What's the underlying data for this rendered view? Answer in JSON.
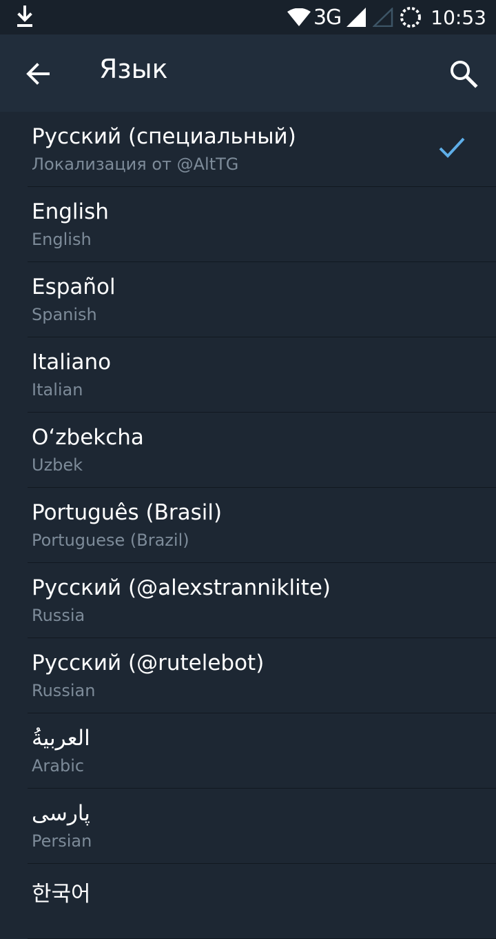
{
  "status_bar": {
    "network": "3G",
    "time": "10:53"
  },
  "header": {
    "title": "Язык"
  },
  "languages": [
    {
      "name": "Русский (специальный)",
      "subtitle": "Локализация от @AltTG",
      "selected": true
    },
    {
      "name": "English",
      "subtitle": "English",
      "selected": false
    },
    {
      "name": "Español",
      "subtitle": "Spanish",
      "selected": false
    },
    {
      "name": "Italiano",
      "subtitle": "Italian",
      "selected": false
    },
    {
      "name": "Oʻzbekcha",
      "subtitle": "Uzbek",
      "selected": false
    },
    {
      "name": "Português (Brasil)",
      "subtitle": "Portuguese (Brazil)",
      "selected": false
    },
    {
      "name": "Русский (@alexstranniklite)",
      "subtitle": "Russia",
      "selected": false
    },
    {
      "name": "Русский (@rutelebot)",
      "subtitle": "Russian",
      "selected": false
    },
    {
      "name": "العربيةُ",
      "subtitle": "Arabic",
      "selected": false
    },
    {
      "name": "پارسی",
      "subtitle": "Persian",
      "selected": false
    },
    {
      "name": "한국어",
      "subtitle": "",
      "selected": false
    }
  ],
  "colors": {
    "background": "#1d2733",
    "appbar": "#212d3b",
    "statusbar": "#18212b",
    "accent_check": "#5eaee8",
    "subtitle_text": "#7d8b99"
  },
  "icons": {
    "download": "download-icon",
    "wifi": "wifi-icon",
    "signal": "signal-icon",
    "sync": "sync-icon",
    "back": "arrow-back-icon",
    "search": "search-icon",
    "check": "check-icon"
  }
}
